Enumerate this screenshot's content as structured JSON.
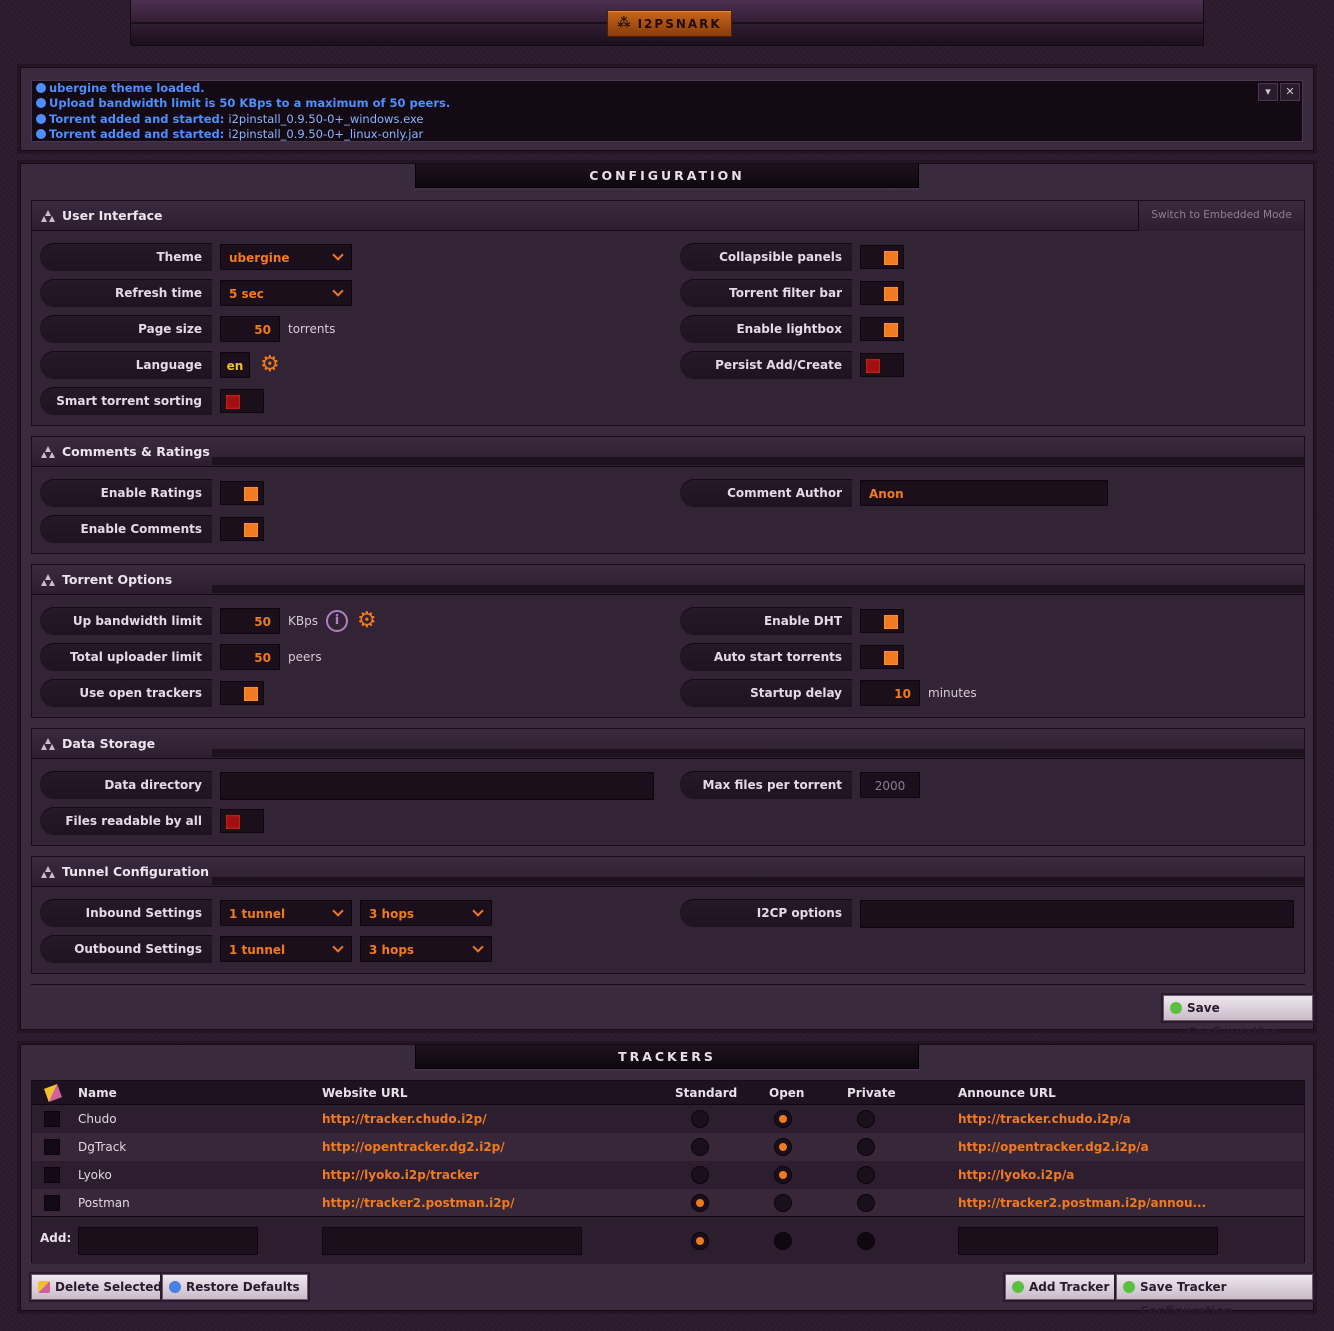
{
  "app": {
    "logo_label": "I2PSNARK",
    "logo_icon": "i2p-snark-icon"
  },
  "messages": {
    "lines": [
      {
        "text": "ubergine theme loaded.",
        "file": ""
      },
      {
        "text": "Upload bandwidth limit is 50 KBps to a maximum of 50 peers.",
        "file": ""
      },
      {
        "text": "Torrent added and started: ",
        "file": "i2pinstall_0.9.50-0+_windows.exe"
      },
      {
        "text": "Torrent added and started: ",
        "file": "i2pinstall_0.9.50-0+_linux-only.jar"
      }
    ],
    "controls": {
      "expand": "▾",
      "close": "✕"
    },
    "color": "#4e8fff"
  },
  "configuration": {
    "title": "CONFIGURATION",
    "save_label": "Save Configuration",
    "user_interface": {
      "title": "User Interface",
      "embedded_mode": "Switch to Embedded Mode",
      "theme_label": "Theme",
      "theme_value": "ubergine",
      "refresh_label": "Refresh time",
      "refresh_value": "5 sec",
      "page_size_label": "Page size",
      "page_size_value": "50",
      "page_size_unit": "torrents",
      "language_label": "Language",
      "language_value": "en",
      "smart_sort_label": "Smart torrent sorting",
      "smart_sort": false,
      "collapsible_label": "Collapsible panels",
      "collapsible": true,
      "filter_bar_label": "Torrent filter bar",
      "filter_bar": true,
      "lightbox_label": "Enable lightbox",
      "lightbox": true,
      "persist_label": "Persist Add/Create",
      "persist": false
    },
    "comments": {
      "title": "Comments & Ratings",
      "ratings_label": "Enable Ratings",
      "ratings": true,
      "comments_label": "Enable Comments",
      "comments": true,
      "author_label": "Comment Author",
      "author_value": "Anon"
    },
    "torrent_options": {
      "title": "Torrent Options",
      "up_bw_label": "Up bandwidth limit",
      "up_bw_value": "50",
      "up_bw_unit": "KBps",
      "uploaders_label": "Total uploader limit",
      "uploaders_value": "50",
      "uploaders_unit": "peers",
      "open_trackers_label": "Use open trackers",
      "open_trackers": true,
      "dht_label": "Enable DHT",
      "dht": true,
      "autostart_label": "Auto start torrents",
      "autostart": true,
      "startup_label": "Startup delay",
      "startup_value": "10",
      "startup_unit": "minutes"
    },
    "data_storage": {
      "title": "Data Storage",
      "dir_label": "Data directory",
      "dir_value": "",
      "readable_label": "Files readable by all",
      "readable": false,
      "max_files_label": "Max files per torrent",
      "max_files_value": "2000"
    },
    "tunnel": {
      "title": "Tunnel Configuration",
      "inbound_label": "Inbound Settings",
      "inbound_tunnels": "1 tunnel",
      "inbound_hops": "3 hops",
      "outbound_label": "Outbound Settings",
      "outbound_tunnels": "1 tunnel",
      "outbound_hops": "3 hops",
      "i2cp_label": "I2CP options",
      "i2cp_value": ""
    }
  },
  "trackers": {
    "title": "TRACKERS",
    "columns": {
      "name": "Name",
      "website": "Website URL",
      "standard": "Standard",
      "open": "Open",
      "private": "Private",
      "announce": "Announce URL"
    },
    "rows": [
      {
        "name": "Chudo",
        "website": "http://tracker.chudo.i2p/",
        "type": "open",
        "announce": "http://tracker.chudo.i2p/a"
      },
      {
        "name": "DgTrack",
        "website": "http://opentracker.dg2.i2p/",
        "type": "open",
        "announce": "http://opentracker.dg2.i2p/a"
      },
      {
        "name": "Lyoko",
        "website": "http://lyoko.i2p/tracker",
        "type": "open",
        "announce": "http://lyoko.i2p/a"
      },
      {
        "name": "Postman",
        "website": "http://tracker2.postman.i2p/",
        "type": "standard",
        "announce": "http://tracker2.postman.i2p/annou..."
      }
    ],
    "add_label": "Add:",
    "delete_label": "Delete Selected",
    "restore_label": "Restore Defaults",
    "add_tracker_label": "Add Tracker",
    "save_label": "Save Tracker Configuration"
  },
  "colors": {
    "accent": "#f07a1e",
    "background": "#2b1a2c",
    "toggle_off": "#a01010"
  }
}
